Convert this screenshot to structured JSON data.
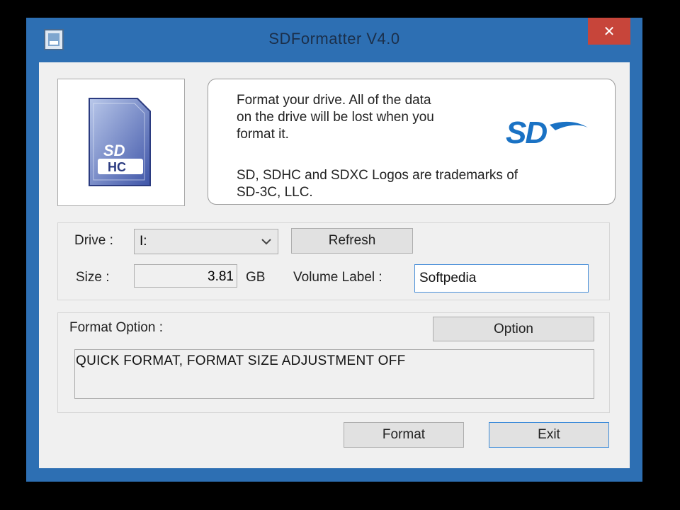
{
  "window": {
    "title": "SDFormatter V4.0",
    "close_label": "✕"
  },
  "info": {
    "line1": "Format your drive. All of the data",
    "line2": "on the drive will be lost when you",
    "line3": "format it.",
    "line4": "SD, SDHC and SDXC Logos are trademarks of",
    "line5": "SD-3C, LLC.",
    "sd_logo_text": "SD",
    "card_logo_text": "SD",
    "card_sub_text": "HC"
  },
  "drive": {
    "label": "Drive :",
    "selected": "I:",
    "refresh_label": "Refresh"
  },
  "size": {
    "label": "Size :",
    "value": "3.81",
    "unit": "GB"
  },
  "volume": {
    "label": "Volume Label :",
    "value": "Softpedia"
  },
  "format_option": {
    "label": "Format Option :",
    "option_button": "Option",
    "current": "QUICK FORMAT, FORMAT SIZE ADJUSTMENT OFF"
  },
  "actions": {
    "format_label": "Format",
    "exit_label": "Exit"
  },
  "colors": {
    "titlebar": "#2d6fb3",
    "close": "#c7453a",
    "sd_blue": "#1a72c4"
  }
}
